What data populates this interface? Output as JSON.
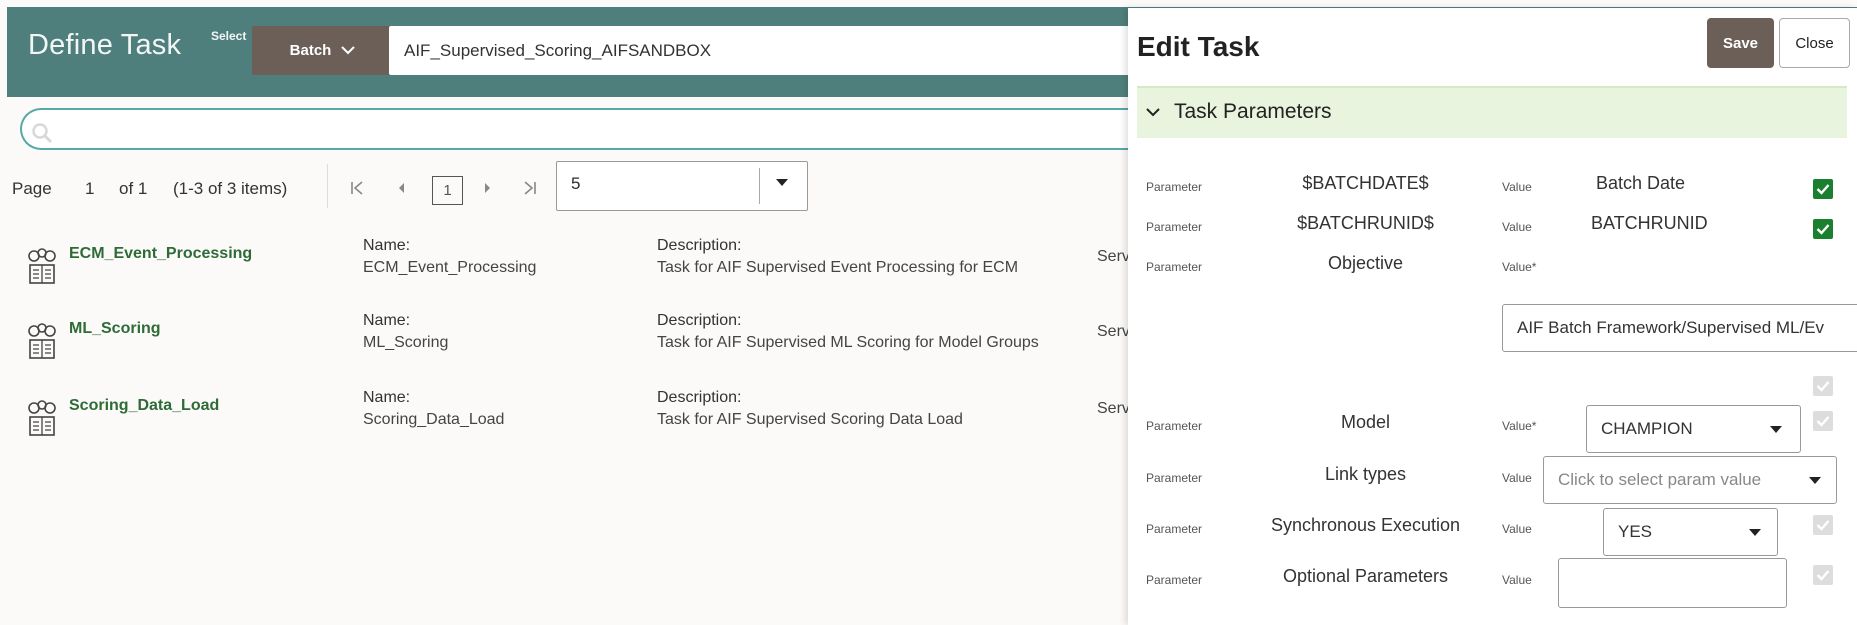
{
  "header": {
    "title": "Define Task",
    "select_label": "Select",
    "batch_button": "Batch",
    "batch_value": "AIF_Supervised_Scoring_AIFSANDBOX"
  },
  "search": {
    "placeholder": ""
  },
  "pager": {
    "page_label": "Page",
    "page_current": "1",
    "of_label": "of 1",
    "items_label": "(1-3 of 3 items)",
    "page_box": "1",
    "page_size": "5"
  },
  "tasks": [
    {
      "title": "ECM_Event_Processing",
      "name_label": "Name:",
      "name": "ECM_Event_Processing",
      "desc_label": "Description:",
      "description": "Task for AIF Supervised Event Processing for ECM",
      "extra": "Serv"
    },
    {
      "title": "ML_Scoring",
      "name_label": "Name:",
      "name": "ML_Scoring",
      "desc_label": "Description:",
      "description": "Task for AIF Supervised ML Scoring for Model Groups",
      "extra": "Serv"
    },
    {
      "title": "Scoring_Data_Load",
      "name_label": "Name:",
      "name": "Scoring_Data_Load",
      "desc_label": "Description:",
      "description": "Task for AIF Supervised Scoring Data Load",
      "extra": "Serv"
    }
  ],
  "panel": {
    "title": "Edit Task",
    "save": "Save",
    "close": "Close",
    "section": "Task Parameters",
    "params": [
      {
        "label": "Parameter",
        "name": "$BATCHDATE$",
        "value_label": "Value",
        "value": "Batch Date",
        "checked": true
      },
      {
        "label": "Parameter",
        "name": "$BATCHRUNID$",
        "value_label": "Value",
        "value": "BATCHRUNID",
        "checked": true
      },
      {
        "label": "Parameter",
        "name": "Objective",
        "value_label": "Value*",
        "value": "AIF Batch Framework/Supervised ML/Ev"
      },
      {
        "label": "Parameter",
        "name": "Model",
        "value_label": "Value*",
        "value": "CHAMPION"
      },
      {
        "label": "Parameter",
        "name": "Link types",
        "value_label": "Value",
        "value": "",
        "placeholder": "Click to select param value"
      },
      {
        "label": "Parameter",
        "name": "Synchronous Execution",
        "value_label": "Value",
        "value": "YES"
      },
      {
        "label": "Parameter",
        "name": "Optional Parameters",
        "value_label": "Value",
        "value": ""
      }
    ]
  },
  "colors": {
    "header_bg": "#4f7f7c",
    "button_bg": "#6c5f58",
    "link_green": "#2e6b37",
    "check_green": "#1a7f2e",
    "section_bg": "#e8f4dd"
  }
}
